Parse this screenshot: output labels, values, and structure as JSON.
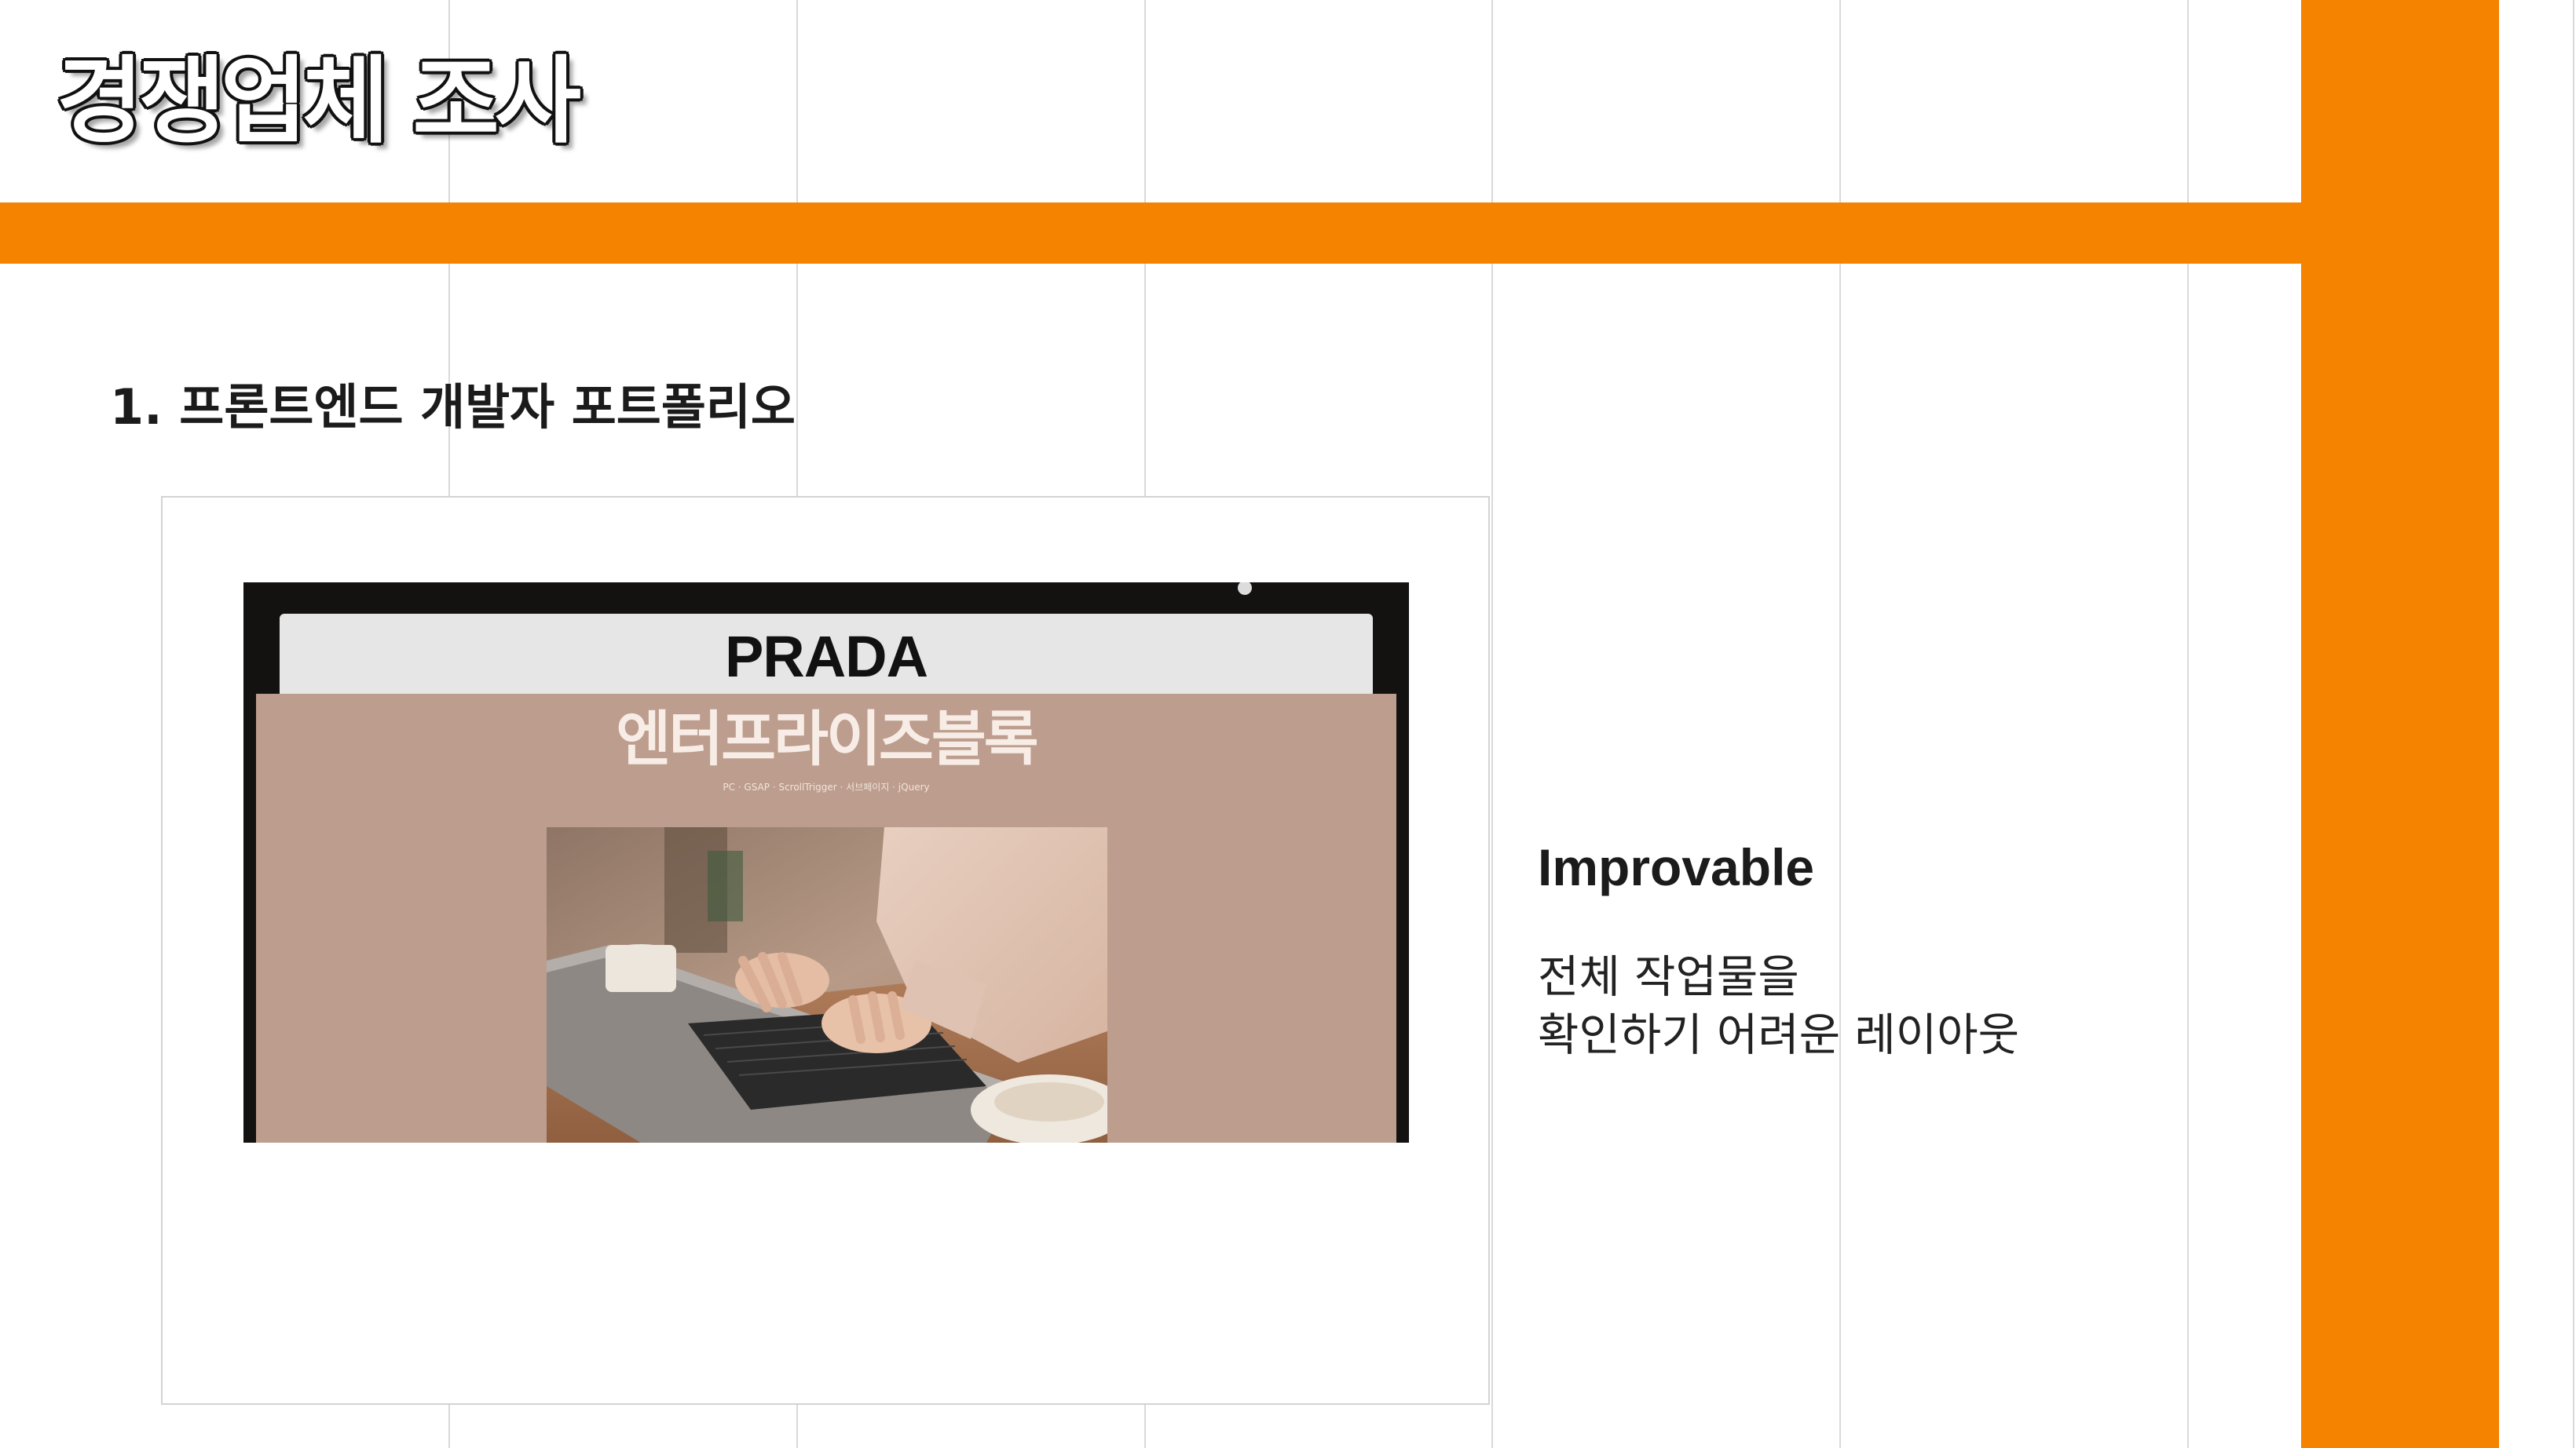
{
  "slide": {
    "title": "경쟁업체 조사",
    "section_heading": "1. 프론트엔드 개발자 포트폴리오",
    "accent_color": "#f58300"
  },
  "portfolio_preview": {
    "brand": "PRADA",
    "site_title": "엔터프라이즈블록",
    "site_subtitle": "PC · GSAP · ScrollTrigger · 서브페이지 · jQuery",
    "hero_image": "laptop-typing-photo"
  },
  "assessment": {
    "label": "Improvable",
    "lines": [
      "전체 작업물을",
      "확인하기 어려운 레이아웃"
    ]
  }
}
